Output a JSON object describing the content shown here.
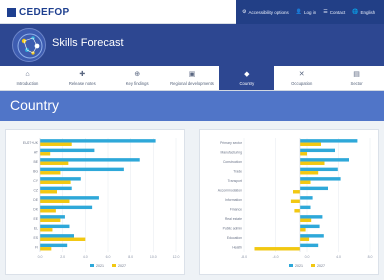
{
  "header": {
    "logo_text": "CEDEFOP",
    "links": [
      {
        "icon": "⚙",
        "label": "Accessibility options"
      },
      {
        "icon": "👤",
        "label": "Log in"
      },
      {
        "icon": "☰",
        "label": "Contact"
      },
      {
        "icon": "🌐",
        "label": "English"
      }
    ]
  },
  "banner": {
    "title": "Skills Forecast"
  },
  "nav": {
    "items": [
      {
        "icon": "⌂",
        "label": "Introduction"
      },
      {
        "icon": "✚",
        "label": "Release notes"
      },
      {
        "icon": "⊕",
        "label": "Key findings"
      },
      {
        "icon": "▣",
        "label": "Regional developments"
      },
      {
        "icon": "◆",
        "label": "Country"
      },
      {
        "icon": "✕",
        "label": "Occupation"
      },
      {
        "icon": "▤",
        "label": "Sector"
      }
    ],
    "active_index": 4
  },
  "page_title": "Country",
  "colors": {
    "primary": "#2d4791",
    "accent": "#5075c8",
    "series_a": "#2ea8d9",
    "series_b": "#f2c811"
  },
  "chart_data": [
    {
      "type": "bar",
      "orientation": "horizontal",
      "categories": [
        "EU27+UK",
        "AT",
        "BE",
        "BG",
        "CY",
        "CZ",
        "DE",
        "DK",
        "EE",
        "EL",
        "ES",
        "FI"
      ],
      "series": [
        {
          "name": "2021",
          "values": [
            10.2,
            4.8,
            8.8,
            7.4,
            3.6,
            2.8,
            5.2,
            4.6,
            2.2,
            2.6,
            3.0,
            2.4
          ]
        },
        {
          "name": "2027",
          "values": [
            2.8,
            0.9,
            2.5,
            1.8,
            2.7,
            1.5,
            2.6,
            1.4,
            1.8,
            1.1,
            4.0,
            1.0
          ]
        }
      ],
      "xlim": [
        0,
        12
      ],
      "x_ticks": [
        "0.0",
        "2.0",
        "4.0",
        "6.0",
        "8.0",
        "10.0",
        "12.0"
      ],
      "legend": [
        "2021",
        "2027"
      ],
      "legend_position": "bottom",
      "grid": true
    },
    {
      "type": "bar",
      "orientation": "horizontal",
      "categories": [
        "Primary sector",
        "Manufacturing",
        "Construction",
        "Trade",
        "Transport",
        "Accommodation",
        "Information",
        "Finance",
        "Real estate",
        "Public admin",
        "Education",
        "Health"
      ],
      "series": [
        {
          "name": "2021",
          "values": [
            8.2,
            5.0,
            7.0,
            5.4,
            5.8,
            4.0,
            1.8,
            1.5,
            3.2,
            2.8,
            3.4,
            2.6
          ]
        },
        {
          "name": "2027",
          "values": [
            3.0,
            1.0,
            3.5,
            2.6,
            1.5,
            -1.0,
            -1.3,
            -0.8,
            1.6,
            0.8,
            1.3,
            -6.5
          ]
        }
      ],
      "xlim": [
        -8,
        10
      ],
      "x_ticks": [
        "-8.0",
        "-4.0",
        "0.0",
        "4.0",
        "8.0"
      ],
      "legend": [
        "2021",
        "2027"
      ],
      "legend_position": "bottom",
      "grid": true
    }
  ]
}
